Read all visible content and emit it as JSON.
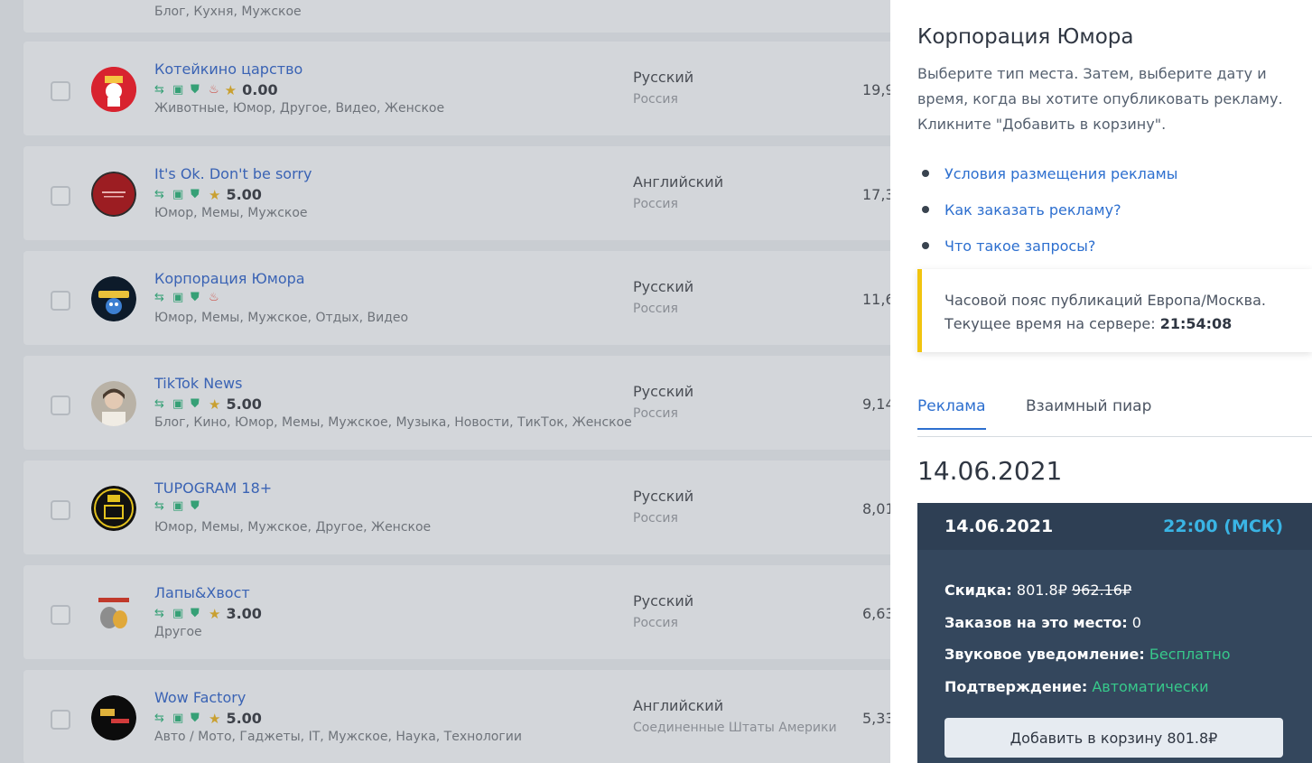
{
  "list": {
    "top_partial": {
      "tags": "Блог, Кухня, Мужское"
    },
    "rows": [
      {
        "name": "Котейкино царство",
        "rating": "0.00",
        "fire": true,
        "star": true,
        "tags": "Животные, Юмор, Другое, Видео, Женское",
        "language": "Русский",
        "country": "Россия",
        "count": "19,9"
      },
      {
        "name": "It's Ok. Don't be sorry",
        "rating": "5.00",
        "fire": false,
        "star": true,
        "tags": "Юмор, Мемы, Мужское",
        "language": "Английский",
        "country": "Россия",
        "count": "17,3"
      },
      {
        "name": "Корпорация Юмора",
        "rating": "",
        "fire": true,
        "star": false,
        "tags": "Юмор, Мемы, Мужское, Отдых, Видео",
        "language": "Русский",
        "country": "Россия",
        "count": "11,6"
      },
      {
        "name": "TikTok News",
        "rating": "5.00",
        "fire": false,
        "star": true,
        "tags": "Блог, Кино, Юмор, Мемы, Мужское, Музыка, Новости, ТикТок, Женское",
        "language": "Русский",
        "country": "Россия",
        "count": "9,14"
      },
      {
        "name": "TUPOGRAM 18+",
        "rating": "",
        "fire": false,
        "star": false,
        "tags": "Юмор, Мемы, Мужское, Другое, Женское",
        "language": "Русский",
        "country": "Россия",
        "count": "8,01"
      },
      {
        "name": "Лапы&Хвост",
        "rating": "3.00",
        "fire": false,
        "star": true,
        "tags": "Другое",
        "language": "Русский",
        "country": "Россия",
        "count": "6,63"
      },
      {
        "name": "Wow Factory",
        "rating": "5.00",
        "fire": false,
        "star": true,
        "tags": "Авто / Мото, Гаджеты, IT, Мужское, Наука, Технологии",
        "language": "Английский",
        "country": "Соединенные Штаты Америки",
        "count": "5,33"
      }
    ]
  },
  "panel": {
    "title": "Корпорация Юмора",
    "description": "Выберите тип места. Затем, выберите дату и время, когда вы хотите опубликовать рекламу. Кликните \"Добавить в корзину\".",
    "links": [
      "Условия размещения рекламы",
      "Как заказать рекламу?",
      "Что такое запросы?"
    ],
    "timezone_line": "Часовой пояс публикаций Европа/Москва.",
    "server_time_label": "Текущее время на сервере:",
    "server_time": "21:54:08",
    "tabs": [
      "Реклама",
      "Взаимный пиар"
    ],
    "selected_date": "14.06.2021",
    "slot": {
      "date": "14.06.2021",
      "time": "22:00 (МСК)",
      "discount_label": "Скидка:",
      "price_new": "801.8₽",
      "price_old": "962.16₽",
      "orders_label": "Заказов на это место:",
      "orders_value": "0",
      "sound_label": "Звуковое уведомление:",
      "sound_value": "Бесплатно",
      "confirm_label": "Подтверждение:",
      "confirm_value": "Автоматически",
      "add_button": "Добавить в корзину 801.8₽"
    }
  }
}
